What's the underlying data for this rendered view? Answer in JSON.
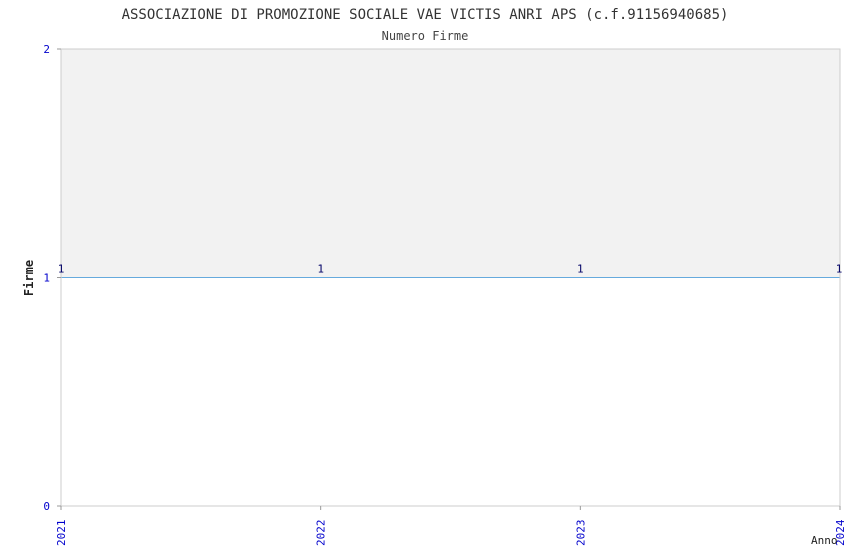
{
  "chart_data": {
    "type": "area",
    "title": "ASSOCIAZIONE DI PROMOZIONE SOCIALE VAE VICTIS ANRI APS (c.f.91156940685)",
    "subtitle": "Numero Firme",
    "xlabel": "Anno",
    "ylabel": "Firme",
    "categories": [
      "2021",
      "2022",
      "2023",
      "2024"
    ],
    "values": [
      1,
      1,
      1,
      1
    ],
    "value_labels": [
      "1",
      "1",
      "1",
      "1"
    ],
    "y_ticks": [
      "0",
      "1",
      "2"
    ],
    "ylim": [
      0,
      2
    ],
    "colors": {
      "title": "#333333",
      "tick_labels": "#0000cc",
      "line": "#66aadd",
      "fill_above": "#f2f2f2",
      "frame": "#cccccc",
      "value_labels": "#000066"
    }
  }
}
